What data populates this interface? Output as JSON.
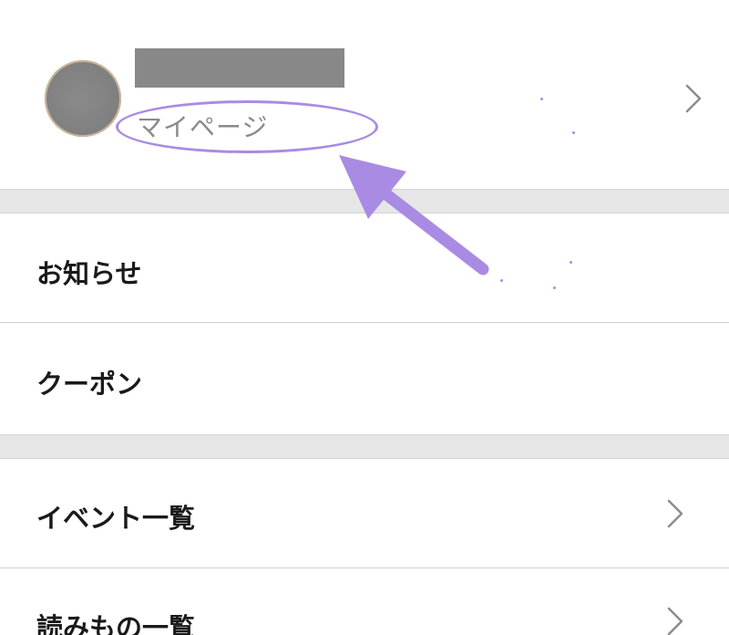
{
  "profile": {
    "mypage_label": "マイページ"
  },
  "menu": {
    "notifications_label": "お知らせ",
    "coupon_label": "クーポン",
    "events_label": "イベント一覧",
    "readings_label": "読みもの一覧"
  },
  "icons": {
    "chevron": "chevron-right-icon",
    "annotation_arrow": "arrow-icon"
  },
  "colors": {
    "annotation": "#a98be3",
    "section_gap": "#e6e6e6",
    "label_text": "#1a1a1a",
    "sublabel_text": "#8a8a8a"
  }
}
